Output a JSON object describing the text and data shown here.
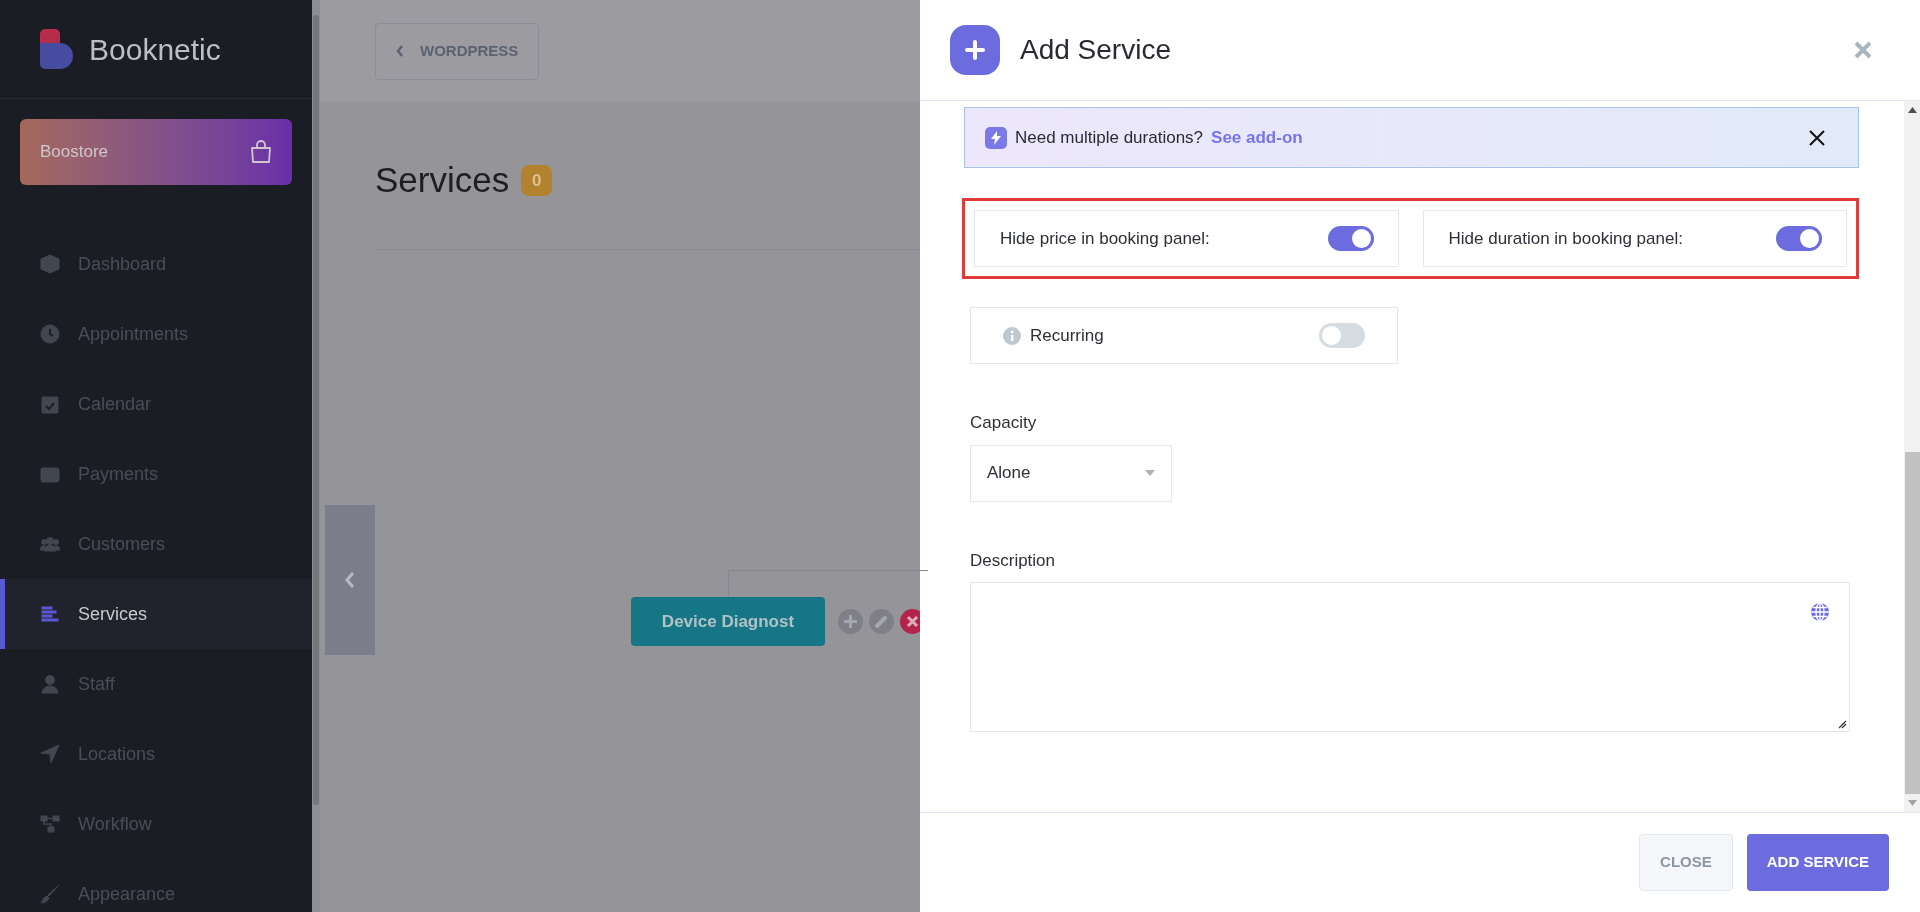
{
  "sidebar": {
    "brand": "Booknetic",
    "store_button": "Boostore",
    "items": [
      {
        "label": "Dashboard",
        "selected": false
      },
      {
        "label": "Appointments",
        "selected": false
      },
      {
        "label": "Calendar",
        "selected": false
      },
      {
        "label": "Payments",
        "selected": false
      },
      {
        "label": "Customers",
        "selected": false
      },
      {
        "label": "Services",
        "selected": true
      },
      {
        "label": "Staff",
        "selected": false
      },
      {
        "label": "Locations",
        "selected": false
      },
      {
        "label": "Workflow",
        "selected": false
      },
      {
        "label": "Appearance",
        "selected": false
      }
    ]
  },
  "back_button": "WORDPRESS",
  "page_title": "Services",
  "count_badge": "0",
  "service_node": "Device Diagnost",
  "dialog": {
    "title": "Add Service",
    "notice": {
      "text": "Need multiple durations?",
      "link": "See add-on"
    },
    "toggles_highlighted": true,
    "toggles": [
      {
        "label": "Hide price in booking panel:",
        "on": true
      },
      {
        "label": "Hide duration in booking panel:",
        "on": true
      }
    ],
    "recurring": {
      "label": "Recurring",
      "on": false
    },
    "capacity": {
      "label": "Capacity",
      "value": "Alone"
    },
    "description": {
      "label": "Description"
    },
    "buttons": [
      {
        "label": "CLOSE",
        "kind": "secondary"
      },
      {
        "label": "ADD SERVICE",
        "kind": "primary"
      }
    ]
  }
}
